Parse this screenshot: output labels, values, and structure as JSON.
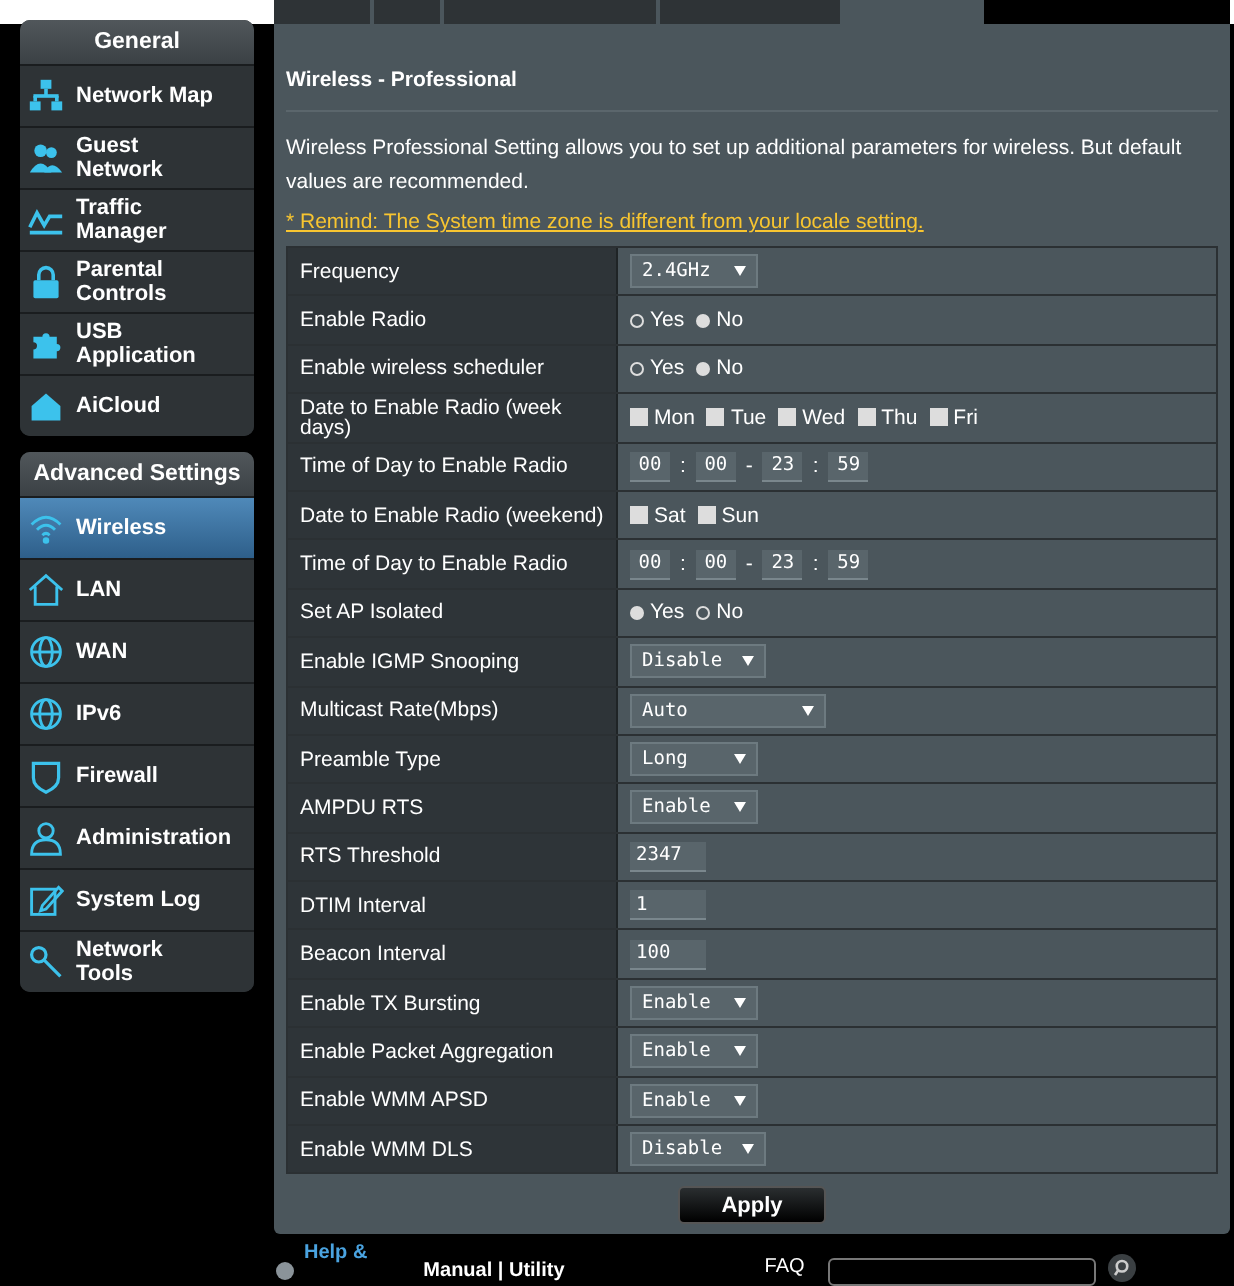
{
  "tabs": [
    {
      "selected": false
    },
    {
      "selected": false
    },
    {
      "selected": false
    },
    {
      "selected": false
    },
    {
      "selected": true
    }
  ],
  "sidebar": {
    "general_title": "General",
    "general_items": [
      {
        "label": "Network Map",
        "selected": false
      },
      {
        "label": "Guest\nNetwork",
        "selected": false
      },
      {
        "label": "Traffic\nManager",
        "selected": false
      },
      {
        "label": "Parental\nControls",
        "selected": false
      },
      {
        "label": "USB\nApplication",
        "selected": false
      },
      {
        "label": "AiCloud",
        "selected": false
      }
    ],
    "advanced_title": "Advanced Settings",
    "advanced_items": [
      {
        "label": "Wireless",
        "selected": true
      },
      {
        "label": "LAN",
        "selected": false
      },
      {
        "label": "WAN",
        "selected": false
      },
      {
        "label": "IPv6",
        "selected": false
      },
      {
        "label": "Firewall",
        "selected": false
      },
      {
        "label": "Administration",
        "selected": false
      },
      {
        "label": "System Log",
        "selected": false
      },
      {
        "label": "Network\nTools",
        "selected": false
      }
    ]
  },
  "page": {
    "title": "Wireless - Professional",
    "description": "Wireless Professional Setting allows you to set up additional parameters for wireless. But default values are recommended.",
    "remind": "* Remind: The System time zone is different from your locale setting."
  },
  "settings": [
    {
      "label": "Frequency",
      "kind": "select",
      "value": "2.4GHz",
      "wide": false
    },
    {
      "label": "Enable Radio",
      "kind": "radio",
      "options": [
        {
          "label": "Yes",
          "selected": false
        },
        {
          "label": "No",
          "selected": true
        }
      ]
    },
    {
      "label": "Enable wireless scheduler",
      "kind": "radio",
      "options": [
        {
          "label": "Yes",
          "selected": false
        },
        {
          "label": "No",
          "selected": true
        }
      ]
    },
    {
      "label": "Date to Enable Radio (week days)",
      "kind": "checks",
      "options": [
        {
          "label": "Mon",
          "checked": true
        },
        {
          "label": "Tue",
          "checked": true
        },
        {
          "label": "Wed",
          "checked": true
        },
        {
          "label": "Thu",
          "checked": true
        },
        {
          "label": "Fri",
          "checked": true
        }
      ]
    },
    {
      "label": "Time of Day to Enable Radio",
      "kind": "time",
      "parts": [
        "00",
        "00",
        "23",
        "59"
      ],
      "separators": [
        ":",
        "-",
        ":"
      ]
    },
    {
      "label": "Date to Enable Radio (weekend)",
      "kind": "checks",
      "options": [
        {
          "label": "Sat",
          "checked": true
        },
        {
          "label": "Sun",
          "checked": true
        }
      ]
    },
    {
      "label": "Time of Day to Enable Radio",
      "kind": "time",
      "parts": [
        "00",
        "00",
        "23",
        "59"
      ],
      "separators": [
        ":",
        "-",
        ":"
      ]
    },
    {
      "label": "Set AP Isolated",
      "kind": "radio",
      "options": [
        {
          "label": "Yes",
          "selected": true
        },
        {
          "label": "No",
          "selected": false
        }
      ]
    },
    {
      "label": "Enable IGMP Snooping",
      "kind": "select",
      "value": "Disable",
      "wide": false
    },
    {
      "label": "Multicast Rate(Mbps)",
      "kind": "select",
      "value": "Auto",
      "wide": true
    },
    {
      "label": "Preamble Type",
      "kind": "select",
      "value": "Long",
      "wide": false
    },
    {
      "label": "AMPDU RTS",
      "kind": "select",
      "value": "Enable",
      "wide": false
    },
    {
      "label": "RTS Threshold",
      "kind": "text",
      "value": "2347"
    },
    {
      "label": "DTIM Interval",
      "kind": "text",
      "value": "1"
    },
    {
      "label": "Beacon Interval",
      "kind": "text",
      "value": "100"
    },
    {
      "label": "Enable TX Bursting",
      "kind": "select",
      "value": "Enable",
      "wide": false
    },
    {
      "label": "Enable Packet Aggregation",
      "kind": "select",
      "value": "Enable",
      "wide": false
    },
    {
      "label": "Enable WMM APSD",
      "kind": "select",
      "value": "Enable",
      "wide": false
    },
    {
      "label": "Enable WMM DLS",
      "kind": "select",
      "value": "Disable",
      "wide": false
    }
  ],
  "apply_button": "Apply",
  "footer": {
    "help": "Help &",
    "links": "Manual | Utility",
    "faq": "FAQ"
  }
}
